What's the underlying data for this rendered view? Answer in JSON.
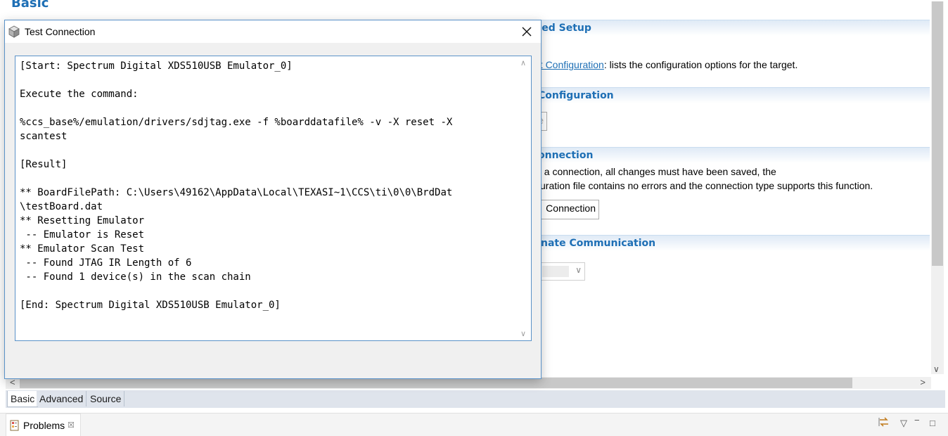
{
  "editor": {
    "page_title": "Basic",
    "sections": [
      {
        "title": "nced Setup"
      },
      {
        "title": "Configuration"
      },
      {
        "title": "onnection"
      },
      {
        "title": "nate Communication"
      }
    ],
    "target_config_link": "et Configuration",
    "target_config_text": ": lists the configuration options for the target.",
    "save_button_label": "e",
    "connection_note_line1": "t a connection, all changes must have been saved, the",
    "connection_note_line2": "uration file contains no errors and the connection type supports this function.",
    "test_connection_button": "Connection",
    "bottom_tabs": [
      {
        "label": "Basic"
      },
      {
        "label": "Advanced"
      },
      {
        "label": "Source"
      }
    ]
  },
  "problems_view": {
    "tab_label": "Problems",
    "close_glyph": "☒"
  },
  "dialog": {
    "title": "Test Connection",
    "close_glyph": "✕",
    "output_lines": [
      "[Start: Spectrum Digital XDS510USB Emulator_0]",
      "",
      "Execute the command:",
      "",
      "%ccs_base%/emulation/drivers/sdjtag.exe -f %boarddatafile% -v -X reset -X",
      "scantest",
      "",
      "[Result]",
      "",
      "** BoardFilePath: C:\\Users\\49162\\AppData\\Local\\TEXASI~1\\CCS\\ti\\0\\0\\BrdDat",
      "\\testBoard.dat",
      "** Resetting Emulator",
      " -- Emulator is Reset",
      "** Emulator Scan Test",
      " -- Found JTAG IR Length of 6",
      " -- Found 1 device(s) in the scan chain",
      "",
      "[End: Spectrum Digital XDS510USB Emulator_0]"
    ]
  },
  "colors": {
    "accent_blue": "#1e6fb5",
    "dialog_border": "#5a92c8"
  },
  "icons": {
    "dialog_app": "app-cube-icon",
    "problems": "problems-icon",
    "view_toolbar": [
      "sync-icon",
      "view-menu-icon",
      "minimize-icon",
      "maximize-icon"
    ]
  }
}
